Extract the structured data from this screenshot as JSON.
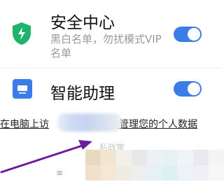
{
  "security": {
    "title": "安全中心",
    "subtitle": "黑白名单，勿扰模式VIP名单",
    "toggle_on": true,
    "icon": "shield-lightning-icon"
  },
  "assistant": {
    "title": "智能助理",
    "toggle_on": true,
    "icon": "assistant-screen-icon"
  },
  "footer": {
    "link_left": "在电脑上访",
    "link_right": "时管理您的个人数据",
    "partial_text": "私政策"
  },
  "colors": {
    "accent": "#3b7ce8",
    "shield_green": "#1fb36b",
    "annotation_arrow": "#6a1b9a"
  }
}
